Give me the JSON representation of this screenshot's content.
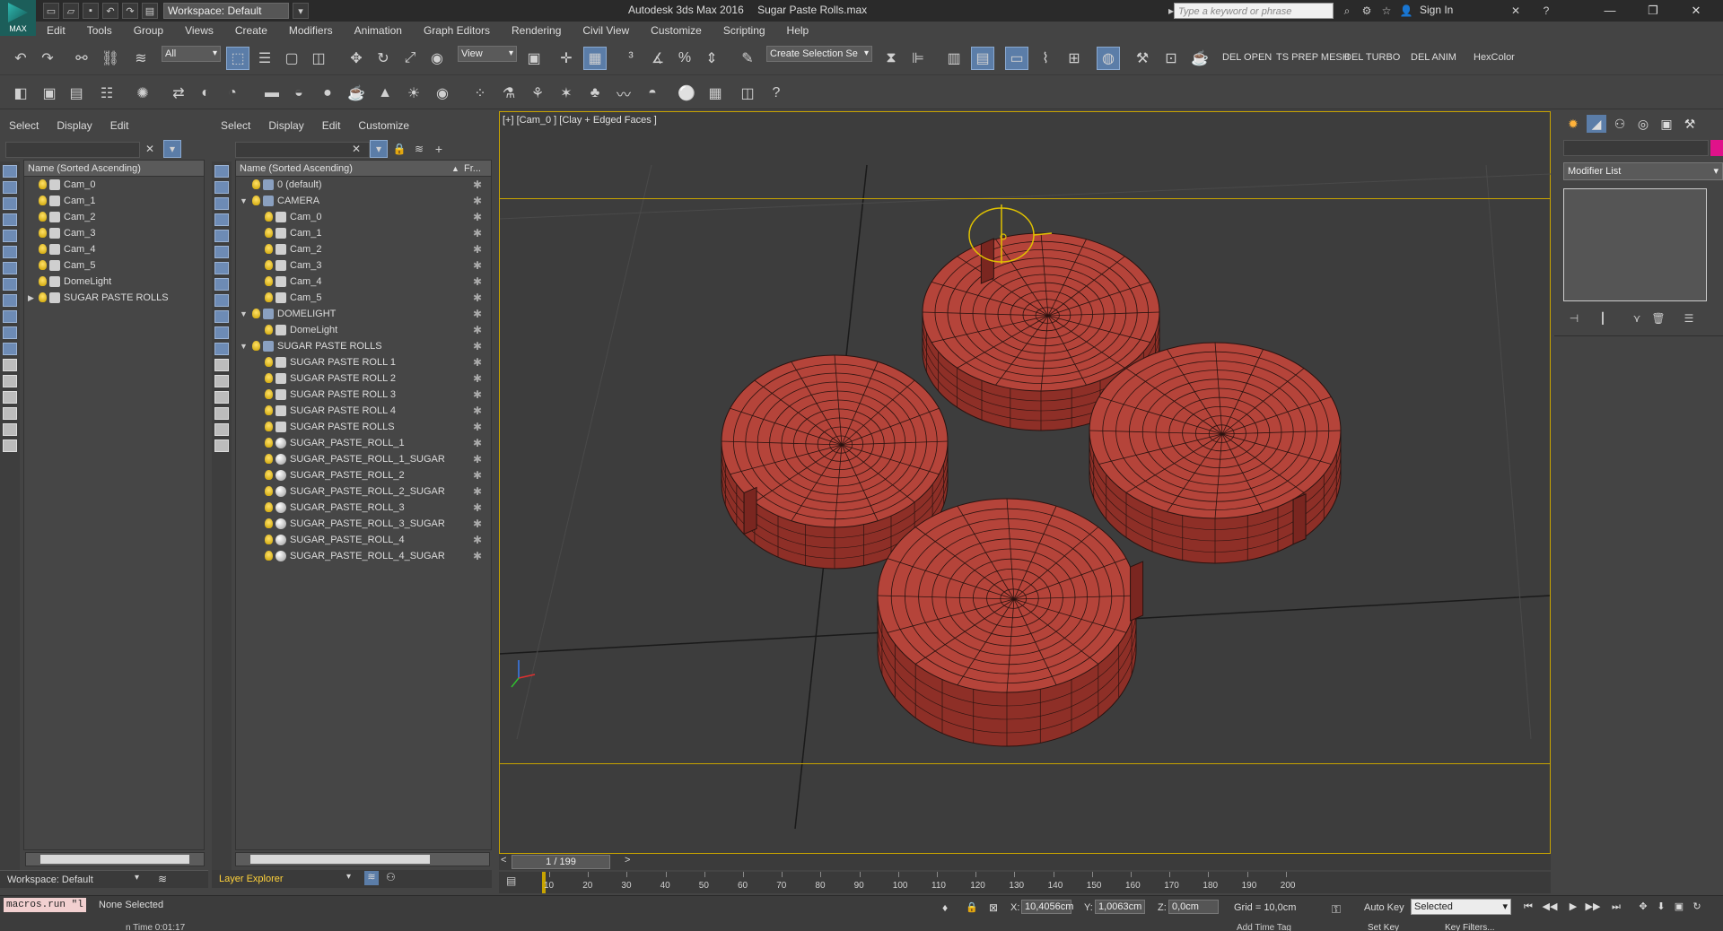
{
  "app": {
    "logo_label": "MAX",
    "workspace": "Workspace: Default",
    "title_app": "Autodesk 3ds Max 2016",
    "title_file": "Sugar Paste Rolls.max",
    "search_placeholder": "Type a keyword or phrase",
    "sign_in": "Sign In"
  },
  "menu": [
    "Edit",
    "Tools",
    "Group",
    "Views",
    "Create",
    "Modifiers",
    "Animation",
    "Graph Editors",
    "Rendering",
    "Civil View",
    "Customize",
    "Scripting",
    "Help"
  ],
  "toolbar": {
    "selection_filter": "All",
    "ref_coord": "View",
    "named_selection": "Create Selection Se",
    "scripts": [
      "DEL OPEN",
      "TS PREP MESH",
      "DEL TURBO",
      "DEL ANIM",
      "HexColor"
    ]
  },
  "explorer_left": {
    "menu": [
      "Select",
      "Display",
      "Edit"
    ],
    "header": "Name (Sorted Ascending)",
    "rows": [
      "Cam_0",
      "Cam_1",
      "Cam_2",
      "Cam_3",
      "Cam_4",
      "Cam_5",
      "DomeLight",
      "SUGAR PASTE ROLLS"
    ]
  },
  "explorer_right": {
    "menu": [
      "Select",
      "Display",
      "Edit",
      "Customize"
    ],
    "header": "Name (Sorted Ascending)",
    "header_col2": "Fr...",
    "rows": [
      {
        "label": "0 (default)",
        "indent": 0,
        "kind": "layer"
      },
      {
        "label": "CAMERA",
        "indent": 0,
        "kind": "layer",
        "expand": "▼"
      },
      {
        "label": "Cam_0",
        "indent": 1,
        "kind": "cam"
      },
      {
        "label": "Cam_1",
        "indent": 1,
        "kind": "cam"
      },
      {
        "label": "Cam_2",
        "indent": 1,
        "kind": "cam"
      },
      {
        "label": "Cam_3",
        "indent": 1,
        "kind": "cam"
      },
      {
        "label": "Cam_4",
        "indent": 1,
        "kind": "cam"
      },
      {
        "label": "Cam_5",
        "indent": 1,
        "kind": "cam"
      },
      {
        "label": "DOMELIGHT",
        "indent": 0,
        "kind": "layer",
        "expand": "▼"
      },
      {
        "label": "DomeLight",
        "indent": 1,
        "kind": "light"
      },
      {
        "label": "SUGAR PASTE ROLLS",
        "indent": 0,
        "kind": "layer",
        "expand": "▼"
      },
      {
        "label": "SUGAR PASTE ROLL 1",
        "indent": 1,
        "kind": "group"
      },
      {
        "label": "SUGAR PASTE ROLL 2",
        "indent": 1,
        "kind": "group"
      },
      {
        "label": "SUGAR PASTE ROLL 3",
        "indent": 1,
        "kind": "group"
      },
      {
        "label": "SUGAR PASTE ROLL 4",
        "indent": 1,
        "kind": "group"
      },
      {
        "label": "SUGAR PASTE ROLLS",
        "indent": 1,
        "kind": "group"
      },
      {
        "label": "SUGAR_PASTE_ROLL_1",
        "indent": 1,
        "kind": "sph"
      },
      {
        "label": "SUGAR_PASTE_ROLL_1_SUGAR",
        "indent": 1,
        "kind": "sph"
      },
      {
        "label": "SUGAR_PASTE_ROLL_2",
        "indent": 1,
        "kind": "sph"
      },
      {
        "label": "SUGAR_PASTE_ROLL_2_SUGAR",
        "indent": 1,
        "kind": "sph"
      },
      {
        "label": "SUGAR_PASTE_ROLL_3",
        "indent": 1,
        "kind": "sph"
      },
      {
        "label": "SUGAR_PASTE_ROLL_3_SUGAR",
        "indent": 1,
        "kind": "sph"
      },
      {
        "label": "SUGAR_PASTE_ROLL_4",
        "indent": 1,
        "kind": "sph"
      },
      {
        "label": "SUGAR_PASTE_ROLL_4_SUGAR",
        "indent": 1,
        "kind": "sph"
      }
    ]
  },
  "viewport": {
    "label": "[+] [Cam_0 ] [Clay + Edged Faces ]",
    "roll_color": "#b5443a",
    "wire_color": "#2a1310",
    "selection_frame": "#c8a400"
  },
  "command_panel": {
    "modifier_list": "Modifier List",
    "object_color": "#e0128a"
  },
  "timeline": {
    "frame": "1 / 199",
    "ticks": [
      "10",
      "20",
      "30",
      "40",
      "50",
      "60",
      "70",
      "80",
      "90",
      "100",
      "110",
      "120",
      "130",
      "140",
      "150",
      "160",
      "170",
      "180",
      "190",
      "200"
    ]
  },
  "footer": {
    "workspace": "Workspace: Default",
    "explorer": "Layer Explorer"
  },
  "status": {
    "maxscript": "macros.run \"l",
    "selection": "None Selected",
    "time": "n Time  0:01:17",
    "x_label": "X:",
    "x_value": "10,4056cm",
    "y_label": "Y:",
    "y_value": "1,0063cm",
    "z_label": "Z:",
    "z_value": "0,0cm",
    "grid": "Grid = 10,0cm",
    "add_time_tag": "Add Time Tag",
    "auto_key": "Auto Key",
    "key_mode": "Selected",
    "set_key": "Set Key",
    "key_filters": "Key Filters..."
  }
}
